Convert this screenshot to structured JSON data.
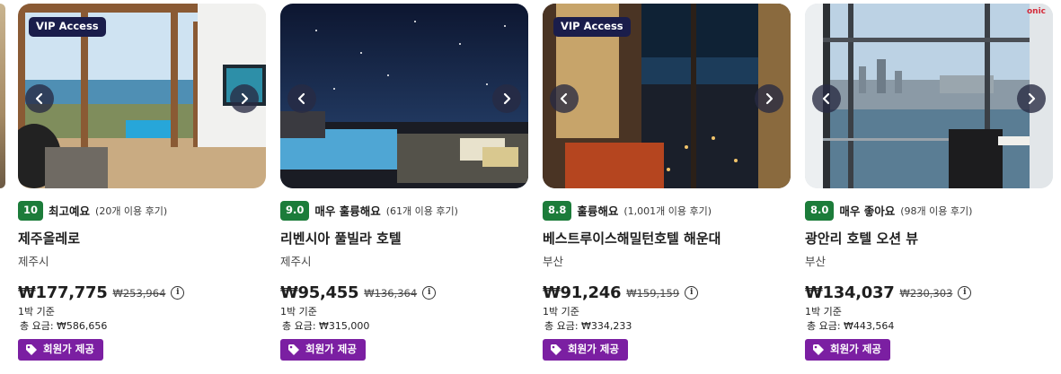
{
  "cards": [
    {
      "vip_label": "VIP Access",
      "score": "10",
      "rating_text": "최고예요",
      "reviews": "(20개 이용 후기)",
      "name": "제주올레로",
      "location": "제주시",
      "price": "₩177,775",
      "old_price": "₩253,964",
      "per_night": "1박 기준",
      "total": "총 요금: ₩586,656",
      "member_label": "회원가 제공"
    },
    {
      "score": "9.0",
      "rating_text": "매우 훌륭해요",
      "reviews": "(61개 이용 후기)",
      "name": "리벤시아 풀빌라 호텔",
      "location": "제주시",
      "price": "₩95,455",
      "old_price": "₩136,364",
      "per_night": "1박 기준",
      "total": "총 요금: ₩315,000",
      "member_label": "회원가 제공"
    },
    {
      "vip_label": "VIP Access",
      "score": "8.8",
      "rating_text": "훌륭해요",
      "reviews": "(1,001개 이용 후기)",
      "name": "베스트루이스해밀턴호텔 해운대",
      "location": "부산",
      "price": "₩91,246",
      "old_price": "₩159,159",
      "per_night": "1박 기준",
      "total": "총 요금: ₩334,233",
      "member_label": "회원가 제공"
    },
    {
      "score": "8.0",
      "rating_text": "매우 좋아요",
      "reviews": "(98개 이용 후기)",
      "name": "광안리 호텔 오션 뷰",
      "location": "부산",
      "price": "₩134,037",
      "old_price": "₩230,303",
      "per_night": "1박 기준",
      "total": "총 요금: ₩443,564",
      "member_label": "회원가 제공",
      "corner_logo": "onic"
    }
  ],
  "icons": {
    "nav_prev": "chevron-left-icon",
    "nav_next": "chevron-right-icon",
    "info": "info-icon",
    "member": "tag-icon"
  },
  "colors": {
    "score_badge": "#1c7c3a",
    "vip_badge": "#1a1d4b",
    "member_badge": "#7b1fa2"
  }
}
